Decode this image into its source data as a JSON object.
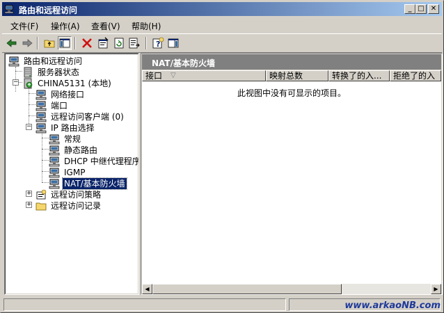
{
  "window": {
    "title": "路由和远程访问"
  },
  "titlebar_buttons": {
    "minimize": "_",
    "maximize": "□",
    "close": "✕"
  },
  "menu": [
    {
      "label": "文件(F)"
    },
    {
      "label": "操作(A)"
    },
    {
      "label": "查看(V)"
    },
    {
      "label": "帮助(H)"
    }
  ],
  "toolbar": [
    "back-icon",
    "forward-icon",
    "up-icon",
    "show-hide-tree-icon",
    "delete-icon",
    "properties-icon",
    "refresh-icon",
    "export-list-icon",
    "help-icon",
    "show-action-pane-icon"
  ],
  "tree": {
    "root": "路由和远程访问",
    "server_status": "服务器状态",
    "server": "CHINA5131 (本地)",
    "network_interfaces": "网络接口",
    "ports": "端口",
    "remote_clients": "远程访问客户端 (0)",
    "ip_routing": "IP 路由选择",
    "general": "常规",
    "static_routes": "静态路由",
    "dhcp_relay": "DHCP 中继代理程序",
    "igmp": "IGMP",
    "nat": "NAT/基本防火墙",
    "remote_policies": "远程访问策略",
    "remote_logging": "远程访问记录"
  },
  "pane": {
    "title": "NAT/基本防火墙",
    "columns": [
      "接口",
      "映射总数",
      "转换了的入...",
      "拒绝了的入"
    ],
    "sort_glyph": "▽",
    "empty_message": "此视图中没有可显示的项目。"
  },
  "watermark": "www.arkaoNB.com",
  "colors": {
    "title_start": "#0a246a",
    "title_end": "#a6caf0",
    "selection": "#0a246a",
    "face": "#d4d0c8"
  }
}
